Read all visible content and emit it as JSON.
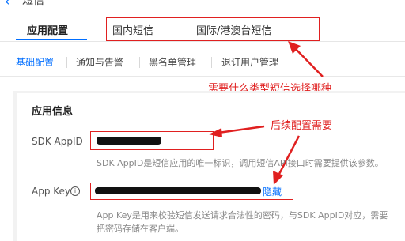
{
  "header": {
    "title_fragment": "短信",
    "back_icon": "chevron-left-icon"
  },
  "tabs": [
    {
      "label": "应用配置",
      "active": true
    },
    {
      "label": "国内短信",
      "active": false
    },
    {
      "label": "国际/港澳台短信",
      "active": false
    }
  ],
  "subnav": [
    {
      "label": "基础配置",
      "active": true
    },
    {
      "label": "通知与告警",
      "active": false
    },
    {
      "label": "黑名单管理",
      "active": false
    },
    {
      "label": "退订用户管理",
      "active": false
    }
  ],
  "annotations": {
    "sms_type_note": "需要什么类型短信选择哪种",
    "later_config_note": "后续配置需要"
  },
  "app_info": {
    "section_title": "应用信息",
    "sdk_appid_label": "SDK AppID",
    "sdk_appid_desc": "SDK AppID是短信应用的唯一标识，调用短信API接口时需要提供该参数。",
    "app_key_label": "App Key",
    "app_key_toggle": "隐藏",
    "app_key_desc_line1": "App Key是用来校验短信发送请求合法性的密码，与SDK AppID对应，需要",
    "app_key_desc_line2": "把密码存储在客户端。"
  },
  "colors": {
    "accent": "#006eff",
    "annotation": "#e02020"
  }
}
